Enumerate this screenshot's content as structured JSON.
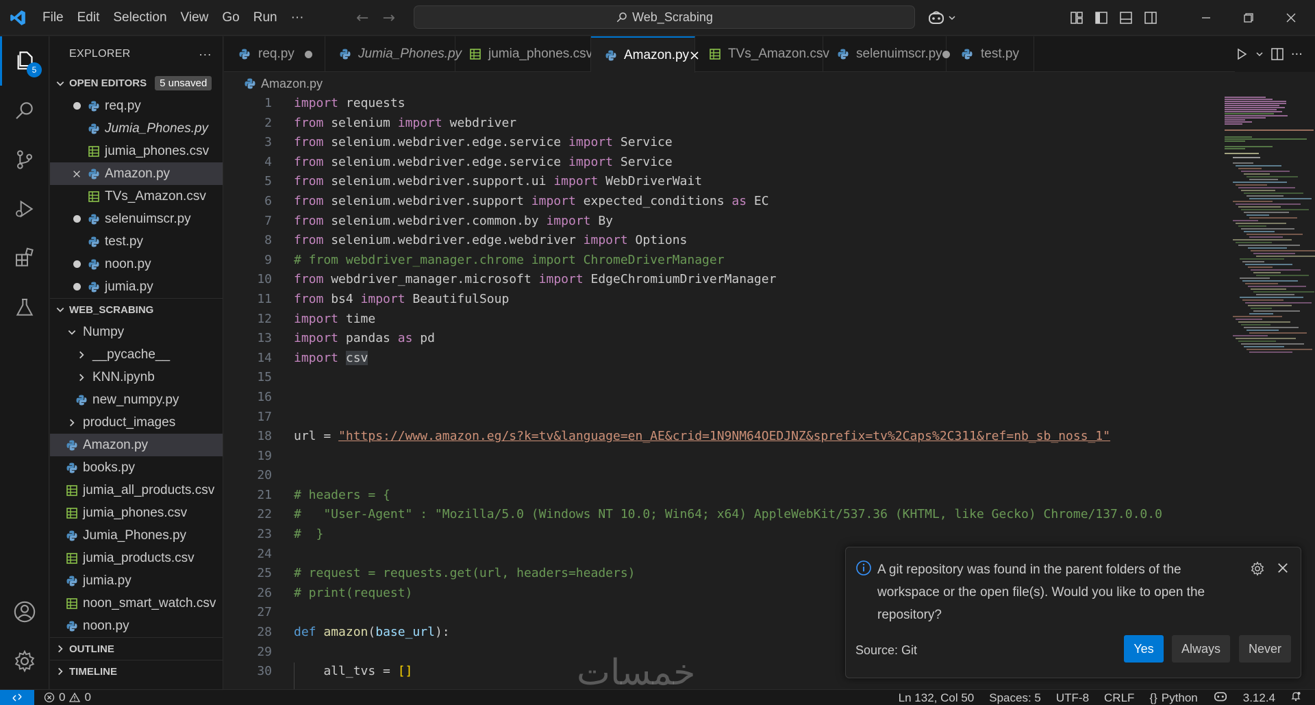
{
  "window": {
    "menu": [
      "File",
      "Edit",
      "Selection",
      "View",
      "Go",
      "Run",
      "···"
    ],
    "search": "Web_Scrabing"
  },
  "activity": {
    "explorer_badge": "5"
  },
  "sidebar": {
    "title": "EXPLORER",
    "more": "···",
    "open_editors": {
      "label": "OPEN EDITORS",
      "badge": "5 unsaved",
      "items": [
        {
          "name": "req.py",
          "type": "py",
          "state": "dot"
        },
        {
          "name": "Jumia_Phones.py",
          "type": "py",
          "state": "italic"
        },
        {
          "name": "jumia_phones.csv",
          "type": "csv",
          "state": ""
        },
        {
          "name": "Amazon.py",
          "type": "py",
          "state": "close"
        },
        {
          "name": "TVs_Amazon.csv",
          "type": "csv",
          "state": ""
        },
        {
          "name": "selenuimscr.py",
          "type": "py",
          "state": "dot"
        },
        {
          "name": "test.py",
          "type": "py",
          "state": ""
        },
        {
          "name": "noon.py",
          "type": "py",
          "state": "dot"
        },
        {
          "name": "jumia.py",
          "type": "py",
          "state": "dot"
        }
      ]
    },
    "workspace": {
      "label": "WEB_SCRABING",
      "items": [
        {
          "name": "Numpy",
          "kind": "folder-open",
          "depth": 0
        },
        {
          "name": "__pycache__",
          "kind": "folder",
          "depth": 1
        },
        {
          "name": "KNN.ipynb",
          "kind": "folder",
          "depth": 1
        },
        {
          "name": "new_numpy.py",
          "kind": "py",
          "depth": 1
        },
        {
          "name": "product_images",
          "kind": "folder",
          "depth": 0
        },
        {
          "name": "Amazon.py",
          "kind": "py",
          "depth": 0
        },
        {
          "name": "books.py",
          "kind": "py",
          "depth": 0
        },
        {
          "name": "jumia_all_products.csv",
          "kind": "csv",
          "depth": 0
        },
        {
          "name": "jumia_phones.csv",
          "kind": "csv",
          "depth": 0
        },
        {
          "name": "Jumia_Phones.py",
          "kind": "py",
          "depth": 0
        },
        {
          "name": "jumia_products.csv",
          "kind": "csv",
          "depth": 0
        },
        {
          "name": "jumia.py",
          "kind": "py",
          "depth": 0
        },
        {
          "name": "noon_smart_watch.csv",
          "kind": "csv",
          "depth": 0
        },
        {
          "name": "noon.py",
          "kind": "py",
          "depth": 0
        }
      ]
    },
    "outline": "OUTLINE",
    "timeline": "TIMELINE"
  },
  "tabs": [
    {
      "name": "req.py",
      "type": "py",
      "state": "dot"
    },
    {
      "name": "Jumia_Phones.py",
      "type": "py",
      "state": "italic"
    },
    {
      "name": "jumia_phones.csv",
      "type": "csv",
      "state": ""
    },
    {
      "name": "Amazon.py",
      "type": "py",
      "state": "active"
    },
    {
      "name": "TVs_Amazon.csv",
      "type": "csv",
      "state": ""
    },
    {
      "name": "selenuimscr.py",
      "type": "py",
      "state": "dot"
    },
    {
      "name": "test.py",
      "type": "py",
      "state": ""
    }
  ],
  "breadcrumb": "Amazon.py",
  "editor": {
    "line_numbers": [
      "1",
      "2",
      "3",
      "4",
      "5",
      "6",
      "7",
      "8",
      "9",
      "10",
      "11",
      "12",
      "13",
      "14",
      "15",
      "16",
      "17",
      "18",
      "19",
      "20",
      "21",
      "22",
      "23",
      "24",
      "25",
      "26",
      "27",
      "28",
      "29",
      "30"
    ],
    "lines": [
      [
        [
          "kw",
          "import"
        ],
        [
          "p",
          " requests"
        ]
      ],
      [
        [
          "kw",
          "from"
        ],
        [
          "p",
          " selenium "
        ],
        [
          "kw",
          "import"
        ],
        [
          "p",
          " webdriver"
        ]
      ],
      [
        [
          "kw",
          "from"
        ],
        [
          "p",
          " selenium.webdriver.edge.service "
        ],
        [
          "kw",
          "import"
        ],
        [
          "p",
          " Service"
        ]
      ],
      [
        [
          "kw",
          "from"
        ],
        [
          "p",
          " selenium.webdriver.edge.service "
        ],
        [
          "kw",
          "import"
        ],
        [
          "p",
          " Service"
        ]
      ],
      [
        [
          "kw",
          "from"
        ],
        [
          "p",
          " selenium.webdriver.support.ui "
        ],
        [
          "kw",
          "import"
        ],
        [
          "p",
          " WebDriverWait"
        ]
      ],
      [
        [
          "kw",
          "from"
        ],
        [
          "p",
          " selenium.webdriver.support "
        ],
        [
          "kw",
          "import"
        ],
        [
          "p",
          " expected_conditions "
        ],
        [
          "kw",
          "as"
        ],
        [
          "p",
          " EC"
        ]
      ],
      [
        [
          "kw",
          "from"
        ],
        [
          "p",
          " selenium.webdriver.common.by "
        ],
        [
          "kw",
          "import"
        ],
        [
          "p",
          " By"
        ]
      ],
      [
        [
          "kw",
          "from"
        ],
        [
          "p",
          " selenium.webdriver.edge.webdriver "
        ],
        [
          "kw",
          "import"
        ],
        [
          "p",
          " Options"
        ]
      ],
      [
        [
          "cm",
          "# from webdriver_manager.chrome import ChromeDriverManager"
        ]
      ],
      [
        [
          "kw",
          "from"
        ],
        [
          "p",
          " webdriver_manager.microsoft "
        ],
        [
          "kw",
          "import"
        ],
        [
          "p",
          " EdgeChromiumDriverManager"
        ]
      ],
      [
        [
          "kw",
          "from"
        ],
        [
          "p",
          " bs4 "
        ],
        [
          "kw",
          "import"
        ],
        [
          "p",
          " BeautifulSoup"
        ]
      ],
      [
        [
          "kw",
          "import"
        ],
        [
          "p",
          " time"
        ]
      ],
      [
        [
          "kw",
          "import"
        ],
        [
          "p",
          " pandas "
        ],
        [
          "kw",
          "as"
        ],
        [
          "p",
          " pd"
        ]
      ],
      [
        [
          "kw",
          "import"
        ],
        [
          "p",
          " "
        ],
        [
          "hl",
          "csv"
        ]
      ],
      [],
      [],
      [],
      [
        [
          "p",
          "url = "
        ],
        [
          "str",
          "\"https://www.amazon.eg/s?k=tv&language=en_AE&crid=1N9NM64OEDJNZ&sprefix=tv%2Caps%2C311&ref=nb_sb_noss_1\""
        ]
      ],
      [],
      [],
      [
        [
          "cm",
          "# headers = {"
        ]
      ],
      [
        [
          "cm",
          "#   \"User-Agent\" : \"Mozilla/5.0 (Windows NT 10.0; Win64; x64) AppleWebKit/537.36 (KHTML, like Gecko) Chrome/137.0.0.0"
        ]
      ],
      [
        [
          "cm",
          "#  }"
        ]
      ],
      [],
      [
        [
          "cm",
          "# request = requests.get(url, headers=headers)"
        ]
      ],
      [
        [
          "cm",
          "# print(request)"
        ]
      ],
      [],
      [
        [
          "kw2",
          "def"
        ],
        [
          "p",
          " "
        ],
        [
          "fn",
          "amazon"
        ],
        [
          "p",
          "("
        ],
        [
          "par",
          "base_url"
        ],
        [
          "p",
          "):"
        ]
      ],
      [],
      [
        [
          "p",
          "    all_tvs = "
        ],
        [
          "br",
          "[]"
        ]
      ]
    ]
  },
  "notification": {
    "message": "A git repository was found in the parent folders of the workspace or the open file(s). Would you like to open the repository?",
    "source": "Source: Git",
    "buttons": [
      "Yes",
      "Always",
      "Never"
    ]
  },
  "statusbar": {
    "errors": "0",
    "warnings": "0",
    "position": "Ln 132, Col 50",
    "spaces": "Spaces: 5",
    "encoding": "UTF-8",
    "eol": "CRLF",
    "language": "Python",
    "python_version": "3.12.4"
  },
  "watermark": "خمسات",
  "colors": {
    "accent": "#0078d4",
    "keyword": "#c586c0",
    "comment": "#6a9955",
    "string": "#ce9178"
  }
}
